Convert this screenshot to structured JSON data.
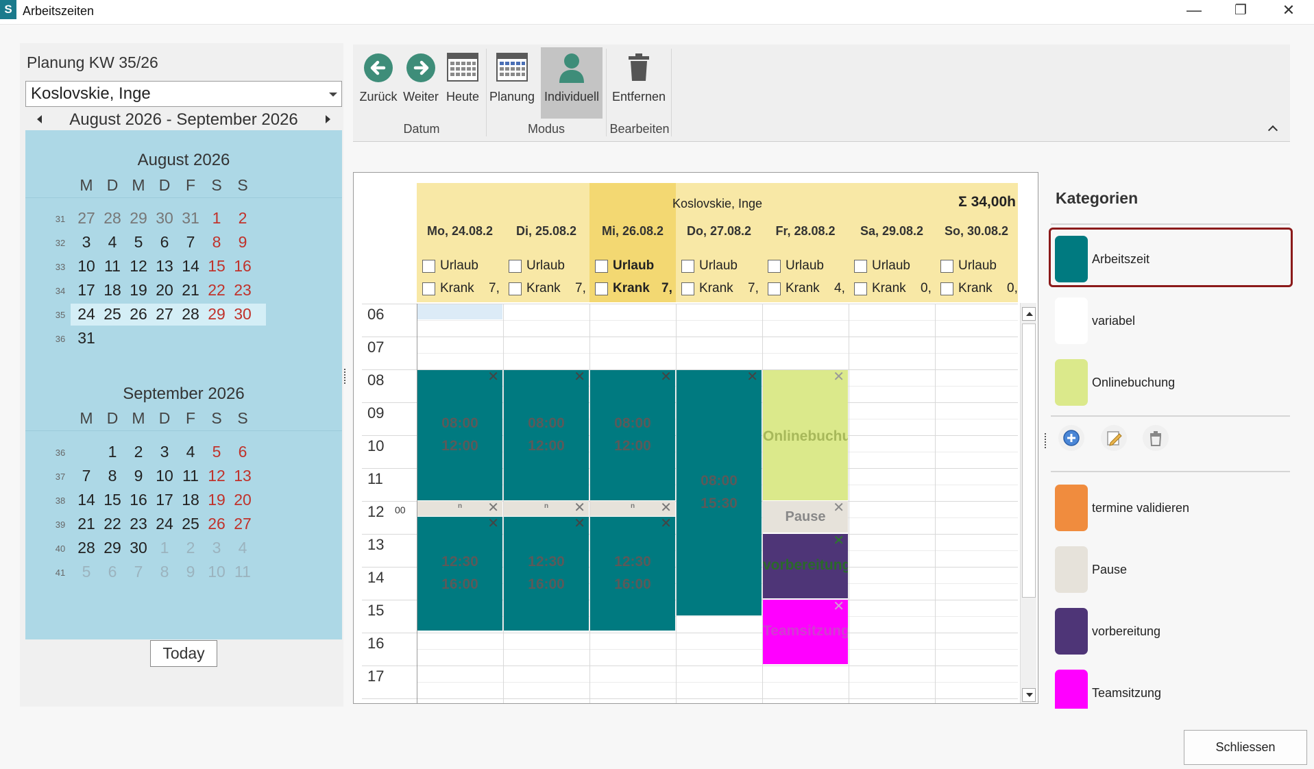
{
  "window": {
    "icon_letter": "S",
    "title": "Arbeitszeiten",
    "minimize": "—",
    "restore": "❐",
    "close": "✕"
  },
  "left": {
    "plan_title": "Planung KW 35/26",
    "person": "Koslovskie, Inge",
    "range": "August 2026 - September 2026",
    "today_label": "Today",
    "dow": [
      "M",
      "D",
      "M",
      "D",
      "F",
      "S",
      "S"
    ],
    "months": [
      {
        "title": "August 2026",
        "weeks": [
          {
            "wk": "31",
            "days": [
              "27",
              "28",
              "29",
              "30",
              "31",
              "1",
              "2"
            ]
          },
          {
            "wk": "32",
            "days": [
              "3",
              "4",
              "5",
              "6",
              "7",
              "8",
              "9"
            ]
          },
          {
            "wk": "33",
            "days": [
              "10",
              "11",
              "12",
              "13",
              "14",
              "15",
              "16"
            ]
          },
          {
            "wk": "34",
            "days": [
              "17",
              "18",
              "19",
              "20",
              "21",
              "22",
              "23"
            ]
          },
          {
            "wk": "35",
            "days": [
              "24",
              "25",
              "26",
              "27",
              "28",
              "29",
              "30"
            ]
          },
          {
            "wk": "36",
            "days": [
              "31",
              "",
              "",
              "",
              "",
              "",
              ""
            ]
          }
        ]
      },
      {
        "title": "September 2026",
        "weeks": [
          {
            "wk": "36",
            "days": [
              "",
              "1",
              "2",
              "3",
              "4",
              "5",
              "6"
            ]
          },
          {
            "wk": "37",
            "days": [
              "7",
              "8",
              "9",
              "10",
              "11",
              "12",
              "13"
            ]
          },
          {
            "wk": "38",
            "days": [
              "14",
              "15",
              "16",
              "17",
              "18",
              "19",
              "20"
            ]
          },
          {
            "wk": "39",
            "days": [
              "21",
              "22",
              "23",
              "24",
              "25",
              "26",
              "27"
            ]
          },
          {
            "wk": "40",
            "days": [
              "28",
              "29",
              "30",
              "1",
              "2",
              "3",
              "4"
            ]
          },
          {
            "wk": "41",
            "days": [
              "5",
              "6",
              "7",
              "8",
              "9",
              "10",
              "11"
            ]
          }
        ]
      }
    ]
  },
  "ribbon": {
    "buttons": {
      "back": "Zurück",
      "forward": "Weiter",
      "today": "Heute",
      "planning": "Planung",
      "individual": "Individuell",
      "remove": "Entfernen"
    },
    "groups": {
      "date": "Datum",
      "mode": "Modus",
      "edit": "Bearbeiten"
    }
  },
  "schedule": {
    "person": "Koslovskie, Inge",
    "sum": "Σ 34,00h",
    "vacation_label": "Urlaub",
    "sick_label": "Krank",
    "days": [
      {
        "name": "Mo, 24.08.2",
        "sick_value": "7,"
      },
      {
        "name": "Di, 25.08.2",
        "sick_value": "7,"
      },
      {
        "name": "Mi, 26.08.2",
        "sick_value": "7,"
      },
      {
        "name": "Do, 27.08.2",
        "sick_value": "7,"
      },
      {
        "name": "Fr, 28.08.2",
        "sick_value": "4,"
      },
      {
        "name": "Sa, 29.08.2",
        "sick_value": "0,"
      },
      {
        "name": "So, 30.08.2",
        "sick_value": "0,"
      }
    ],
    "hours": [
      "06",
      "07",
      "08",
      "09",
      "10",
      "11",
      "12",
      "13",
      "14",
      "15",
      "16",
      "17"
    ],
    "minute_label": "00",
    "close_glyph": "✕",
    "appointments": {
      "mo_am": {
        "start": "08:00",
        "end": "12:00"
      },
      "di_am": {
        "start": "08:00",
        "end": "12:00"
      },
      "mi_am": {
        "start": "08:00",
        "end": "12:00"
      },
      "mo_pm": {
        "start": "12:30",
        "end": "16:00"
      },
      "di_pm": {
        "start": "12:30",
        "end": "16:00"
      },
      "mi_pm": {
        "start": "12:30",
        "end": "16:00"
      },
      "do_day": {
        "start": "08:00",
        "end": "15:30"
      },
      "fr_online": {
        "name": "Onlinebuchung"
      },
      "fr_pause": {
        "name": "Pause"
      },
      "fr_prep": {
        "name": "vorbereitung"
      },
      "fr_team": {
        "name": "Teamsitzung"
      },
      "pause_small_glyph": "n"
    }
  },
  "categories": {
    "title": "Kategorien",
    "items": [
      {
        "label": "Arbeitszeit",
        "color": "#007a80"
      },
      {
        "label": "variabel",
        "color": "#ffffff"
      },
      {
        "label": "Onlinebuchung",
        "color": "#dbe98b"
      },
      {
        "label": "termine validieren",
        "color": "#f08c3e"
      },
      {
        "label": "Pause",
        "color": "#e6e2da"
      },
      {
        "label": "vorbereitung",
        "color": "#4e3577"
      },
      {
        "label": "Teamsitzung",
        "color": "#ff00ff"
      }
    ]
  },
  "footer": {
    "close_label": "Schliessen"
  }
}
